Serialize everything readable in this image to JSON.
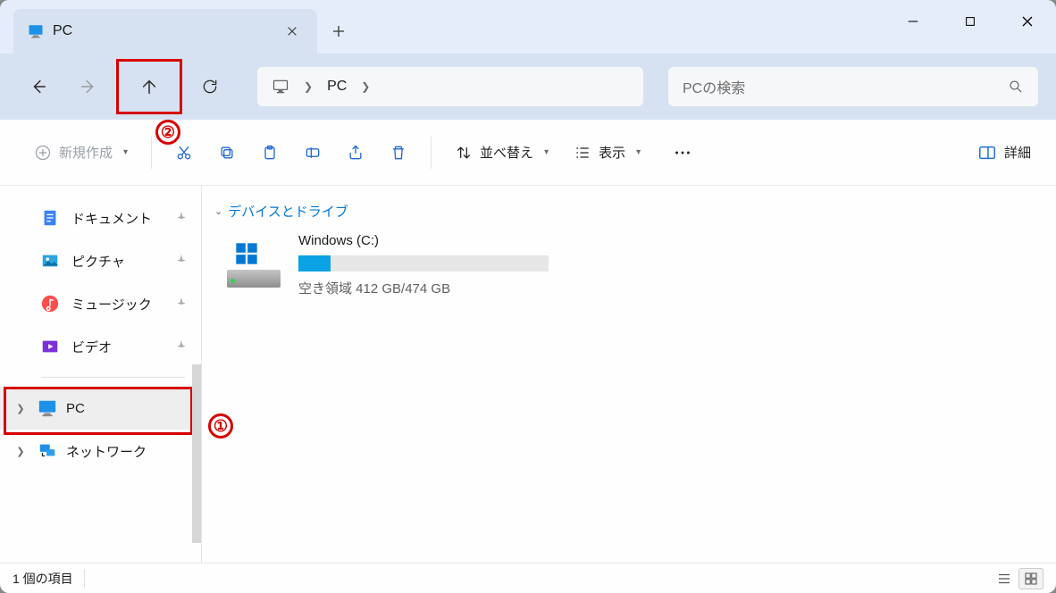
{
  "titlebar": {
    "tab_label": "PC",
    "callouts": {
      "badge1_text": "①",
      "badge2_text": "②"
    }
  },
  "address": {
    "crumb1": "PC"
  },
  "search": {
    "placeholder": "PCの検索"
  },
  "cmdbar": {
    "new_label": "新規作成",
    "sort_label": "並べ替え",
    "view_label": "表示",
    "details_label": "詳細"
  },
  "sidebar": {
    "quick": [
      {
        "label": "ドキュメント"
      },
      {
        "label": "ピクチャ"
      },
      {
        "label": "ミュージック"
      },
      {
        "label": "ビデオ"
      }
    ],
    "tree": {
      "pc_label": "PC",
      "network_label": "ネットワーク"
    }
  },
  "content": {
    "group_label": "デバイスとドライブ",
    "drive": {
      "name": "Windows (C:)",
      "subtitle": "空き領域 412 GB/474 GB",
      "fill_percent": 13
    }
  },
  "statusbar": {
    "item_count_label": "1 個の項目"
  },
  "icons": {
    "monitor": "monitor-icon",
    "close": "close-icon",
    "plus": "plus-icon",
    "minimize": "minimize-icon",
    "maximize": "maximize-icon",
    "window_close": "window-close-icon"
  }
}
